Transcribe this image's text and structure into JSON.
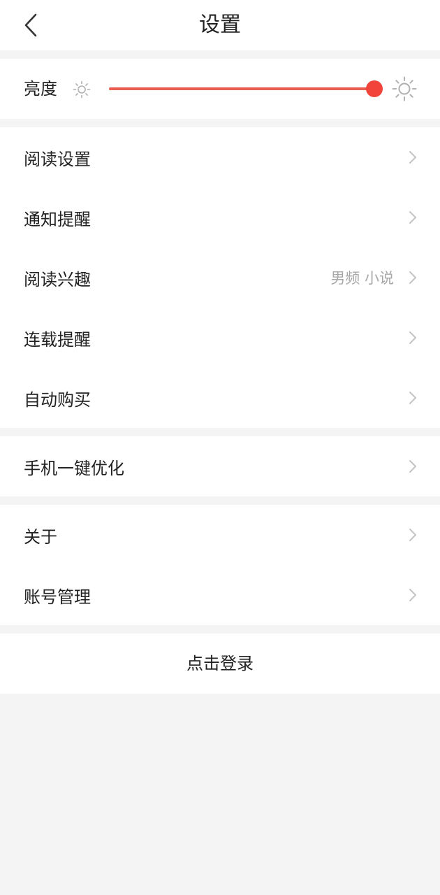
{
  "header": {
    "title": "设置",
    "back_icon": "chevron-left-icon"
  },
  "brightness": {
    "label": "亮度",
    "level_percent": 100,
    "min_icon": "sun-small-icon",
    "max_icon": "sun-large-icon",
    "accent_color": "#f2443a"
  },
  "groups": [
    {
      "items": [
        {
          "label": "阅读设置",
          "value": ""
        },
        {
          "label": "通知提醒",
          "value": ""
        },
        {
          "label": "阅读兴趣",
          "value": "男频 小说"
        },
        {
          "label": "连载提醒",
          "value": ""
        },
        {
          "label": "自动购买",
          "value": ""
        }
      ]
    },
    {
      "items": [
        {
          "label": "手机一键优化",
          "value": ""
        }
      ]
    },
    {
      "items": [
        {
          "label": "关于",
          "value": ""
        },
        {
          "label": "账号管理",
          "value": ""
        }
      ]
    }
  ],
  "login": {
    "label": "点击登录"
  }
}
